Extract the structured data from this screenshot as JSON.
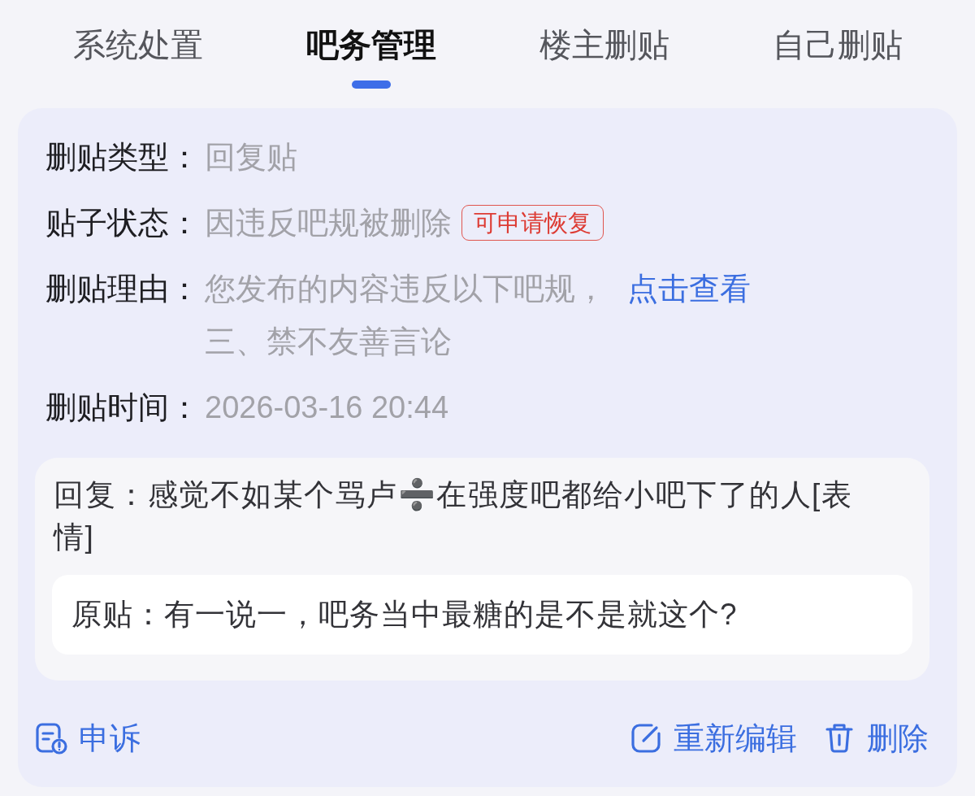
{
  "tabs": [
    {
      "label": "系统处置",
      "selected": false
    },
    {
      "label": "吧务管理",
      "selected": true
    },
    {
      "label": "楼主删贴",
      "selected": false
    },
    {
      "label": "自己删贴",
      "selected": false
    }
  ],
  "details": [
    {
      "label": "删贴类型：",
      "value": "回复贴"
    },
    {
      "label": "贴子状态：",
      "value": "因违反吧规被删除",
      "tag": "可申请恢复"
    },
    {
      "label": "删贴理由：",
      "value": "您发布的内容违反以下吧规，",
      "link": "点击查看",
      "extra": "三、禁不友善言论"
    },
    {
      "label": "删贴时间：",
      "value": "2026-03-16 20:44"
    }
  ],
  "reply": {
    "text": "回复：感觉不如某个骂卢➗在强度吧都给小吧下了的人[表情]",
    "original": "原贴：有一说一，吧务当中最糖的是不是就这个?"
  },
  "actions": {
    "left": [
      {
        "kind": "appeal",
        "label": "申诉"
      }
    ],
    "right": [
      {
        "kind": "edit",
        "label": "重新编辑"
      },
      {
        "kind": "delete",
        "label": "删除"
      }
    ]
  }
}
